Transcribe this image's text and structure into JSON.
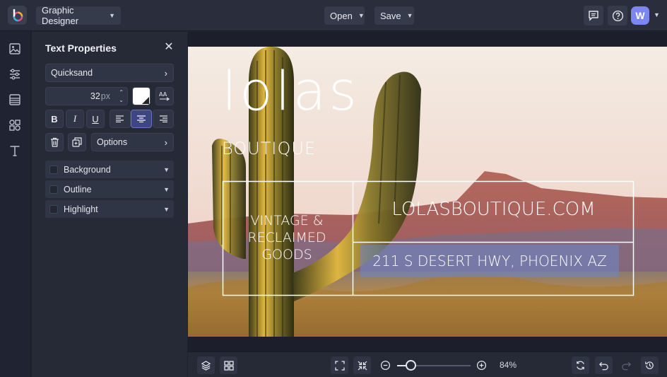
{
  "topbar": {
    "mode_label": "Graphic Designer",
    "open_label": "Open",
    "save_label": "Save",
    "avatar_initial": "W"
  },
  "rail": {
    "items": [
      "image-icon",
      "sliders-icon",
      "layout-icon",
      "shapes-icon",
      "text-icon"
    ]
  },
  "panel": {
    "title": "Text Properties",
    "font_name": "Quicksand",
    "font_size": "32",
    "font_unit": "px",
    "options_label": "Options",
    "accordions": [
      "Background",
      "Outline",
      "Highlight"
    ],
    "active_align": "center",
    "colors": {
      "accent": "#6a74c8",
      "swatch": "#ffffff"
    }
  },
  "design": {
    "brand": "lolas",
    "subtitle": "BOUTIQUE",
    "tagline_1": "VINTAGE &",
    "tagline_2": "RECLAIMED",
    "tagline_3": "GOODS",
    "website": "LOLASBOUTIQUE.COM",
    "address": "211 S DESERT HWY, PHOENIX AZ"
  },
  "bottombar": {
    "zoom_label": "84%",
    "zoom_level": 0.18
  }
}
